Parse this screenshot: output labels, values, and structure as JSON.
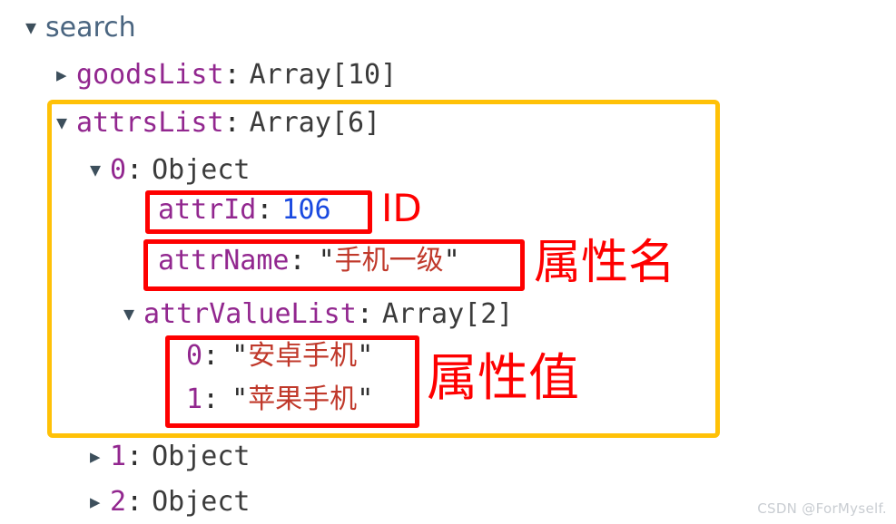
{
  "tree": {
    "root": {
      "toggle": "▼",
      "label": "search"
    },
    "rows": [
      {
        "toggle": "▶",
        "key": "goodsList",
        "colon": ":",
        "type": "Array[10]"
      },
      {
        "toggle": "▼",
        "key": "attrsList",
        "colon": ":",
        "type": "Array[6]"
      },
      {
        "toggle": "▼",
        "key": "0",
        "colon": ":",
        "type": "Object"
      },
      {
        "toggle": "▼",
        "key": "attrValueList",
        "colon": ":",
        "type": "Array[2]"
      },
      {
        "toggle": "▶",
        "key": "1",
        "colon": ":",
        "type": "Object"
      },
      {
        "toggle": "▶",
        "key": "2",
        "colon": ":",
        "type": "Object"
      }
    ],
    "attr_id": {
      "key": "attrId",
      "colon": ":",
      "value": "106"
    },
    "attr_name": {
      "key": "attrName",
      "colon": ":",
      "open_quote": "\"",
      "value": "手机一级",
      "close_quote": "\""
    },
    "attr_values": [
      {
        "index": "0",
        "colon": ":",
        "open_quote": "\"",
        "value": "安卓手机",
        "close_quote": "\""
      },
      {
        "index": "1",
        "colon": ":",
        "open_quote": "\"",
        "value": "苹果手机",
        "close_quote": "\""
      }
    ]
  },
  "annotations": {
    "id": "ID",
    "attr_name": "属性名",
    "attr_value": "属性值"
  },
  "watermark": "CSDN @ForMyself.",
  "colors": {
    "highlight_outer": "#ffc107",
    "highlight_inner": "#fe0000",
    "key": "#92278f",
    "root_key": "#4a6580",
    "type": "#3b3b3b",
    "number": "#1a4ae0",
    "string": "#c0392b",
    "annotation": "#fe0000",
    "watermark": "#c9cdd2"
  }
}
